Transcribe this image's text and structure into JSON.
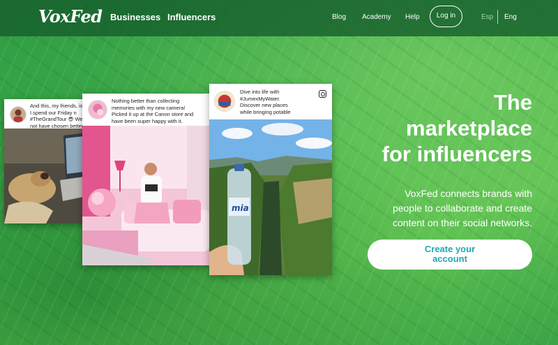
{
  "brand": {
    "logo": "VoxFed"
  },
  "nav": {
    "primary": [
      "Businesses",
      "Influencers"
    ],
    "secondary": [
      "Blog",
      "Academy",
      "Help"
    ],
    "login": "Log in",
    "languages": [
      "Esp",
      "Eng"
    ],
    "active_language": "Eng"
  },
  "hero": {
    "headline_lines": [
      "The",
      "marketplace",
      "for influencers"
    ],
    "subtext_lines": [
      "VoxFed connects brands with",
      "people to collaborate and create",
      "content on their social networks."
    ],
    "cta_lines": [
      "Create your",
      "account"
    ]
  },
  "cards": [
    {
      "caption_lines": [
        "And this, my friends, is h",
        "I spend our Friday n",
        "#TheGrandTour 😎 We",
        "not have chosen better"
      ]
    },
    {
      "caption_lines": [
        "Nothing better than collecting",
        "memories with my new camera!",
        "Picked it up at the Canon store and",
        "have been super happy with it."
      ]
    },
    {
      "caption_lines": [
        "Dive into life with",
        "#JumexMyWater.",
        "Discover new places",
        "while bringing potable"
      ],
      "bottle_label": "mia"
    }
  ],
  "colors": {
    "accent": "#1fa8b3",
    "nav_bg": "#1d6e3a",
    "hero_green": "#46b54c",
    "inactive_language": "#9ed3a2",
    "active_language": "#ffffff"
  },
  "icons": {
    "card_platform": "instagram-icon"
  }
}
